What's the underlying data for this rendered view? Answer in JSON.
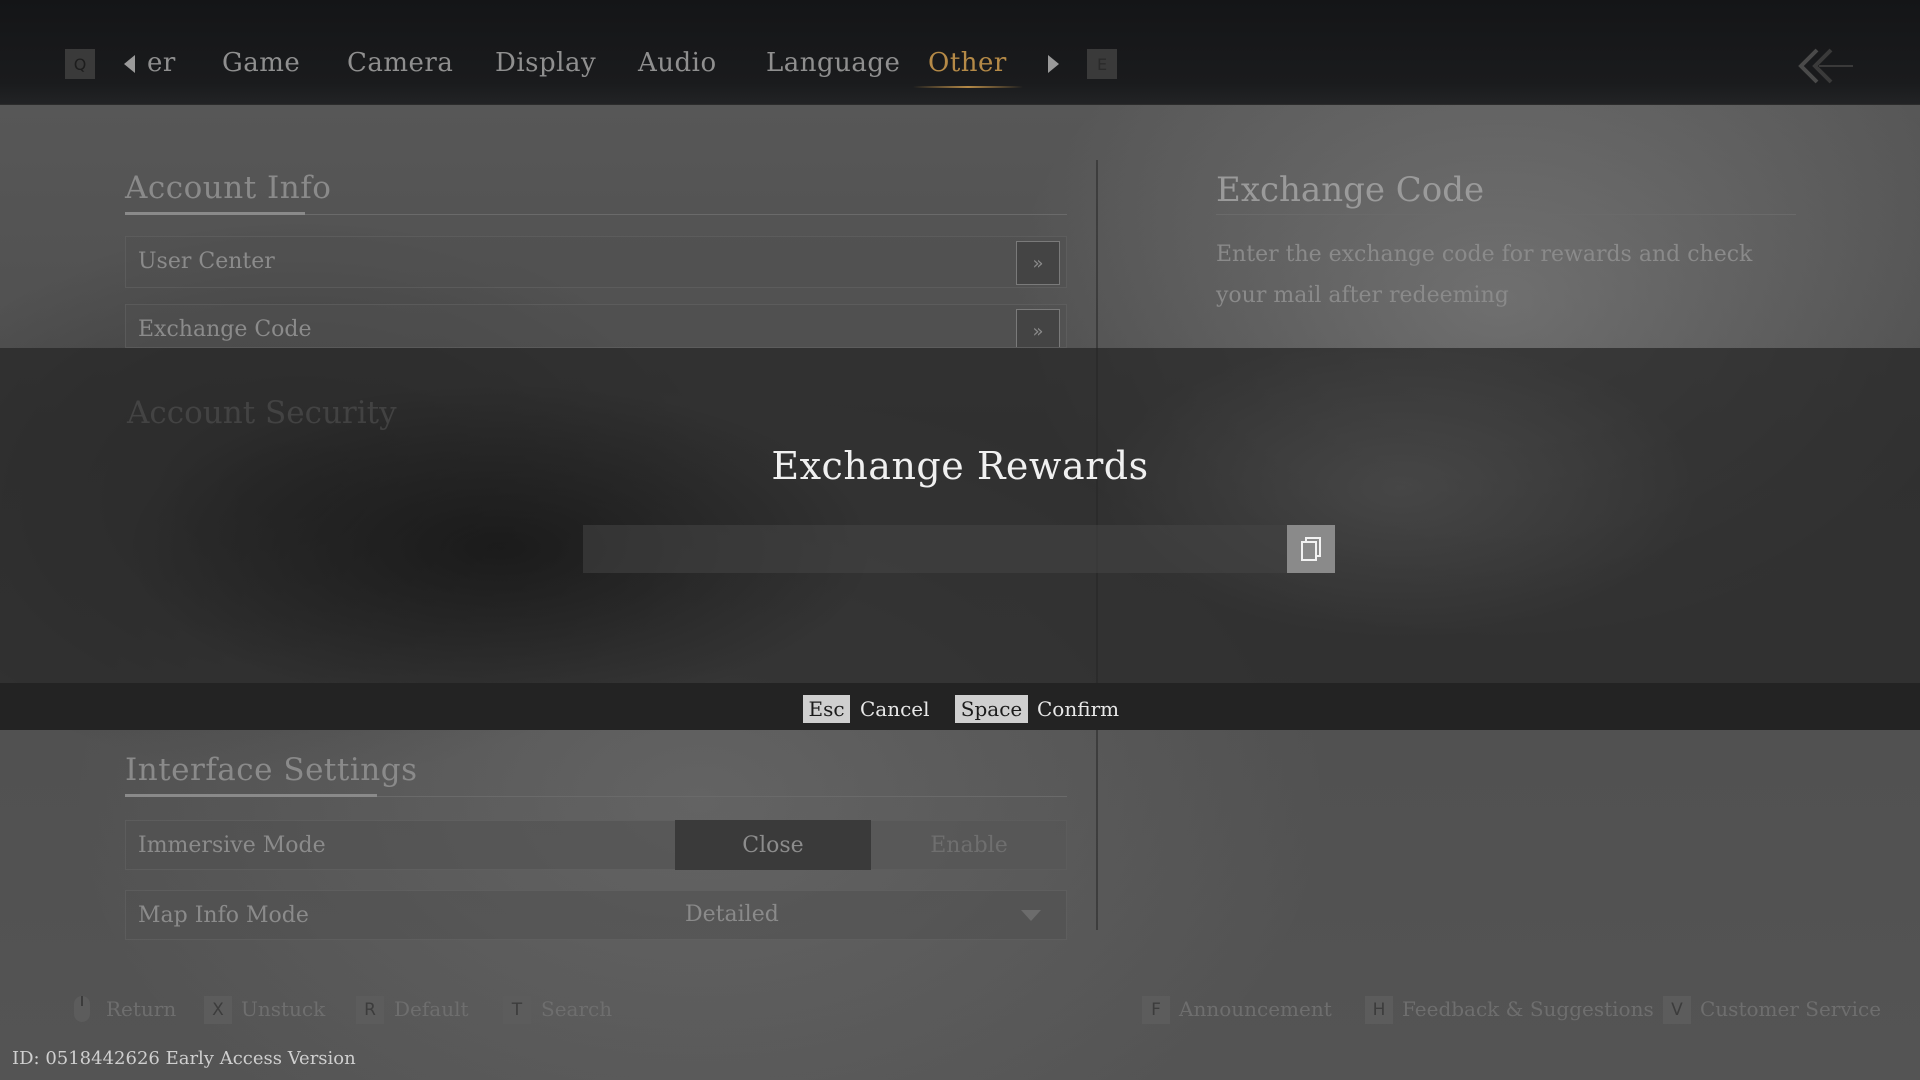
{
  "nav": {
    "left_key": "Q",
    "partial_tab": "er",
    "tabs": [
      "Game",
      "Camera",
      "Display",
      "Audio",
      "Language",
      "Other"
    ],
    "active_tab": "Other",
    "right_key": "E",
    "accent_color": "#b58a47"
  },
  "account": {
    "title": "Account Info",
    "rows": [
      "User Center",
      "Exchange Code"
    ],
    "arrow": "»",
    "obscured_heading": "Account Security"
  },
  "right_panel": {
    "title": "Exchange Code",
    "description": "Enter the exchange code for rewards and check your mail after redeeming"
  },
  "dialog": {
    "title": "Exchange Rewards",
    "input_value": "",
    "paste_icon": "paste-icon",
    "cancel_key": "Esc",
    "cancel_label": "Cancel",
    "confirm_key": "Space",
    "confirm_label": "Confirm"
  },
  "interface": {
    "title": "Interface Settings",
    "immersive_label": "Immersive Mode",
    "immersive_options": [
      "Close",
      "Enable"
    ],
    "immersive_selected": "Close",
    "map_label": "Map Info Mode",
    "map_value": "Detailed"
  },
  "hints": {
    "return_label": "Return",
    "unstuck_key": "X",
    "unstuck_label": "Unstuck",
    "default_key": "R",
    "default_label": "Default",
    "search_key": "T",
    "search_label": "Search",
    "announce_key": "F",
    "announce_label": "Announcement",
    "feedback_key": "H",
    "feedback_label": "Feedback & Suggestions",
    "service_key": "V",
    "service_label": "Customer Service"
  },
  "version_text": "ID: 0518442626 Early Access Version"
}
